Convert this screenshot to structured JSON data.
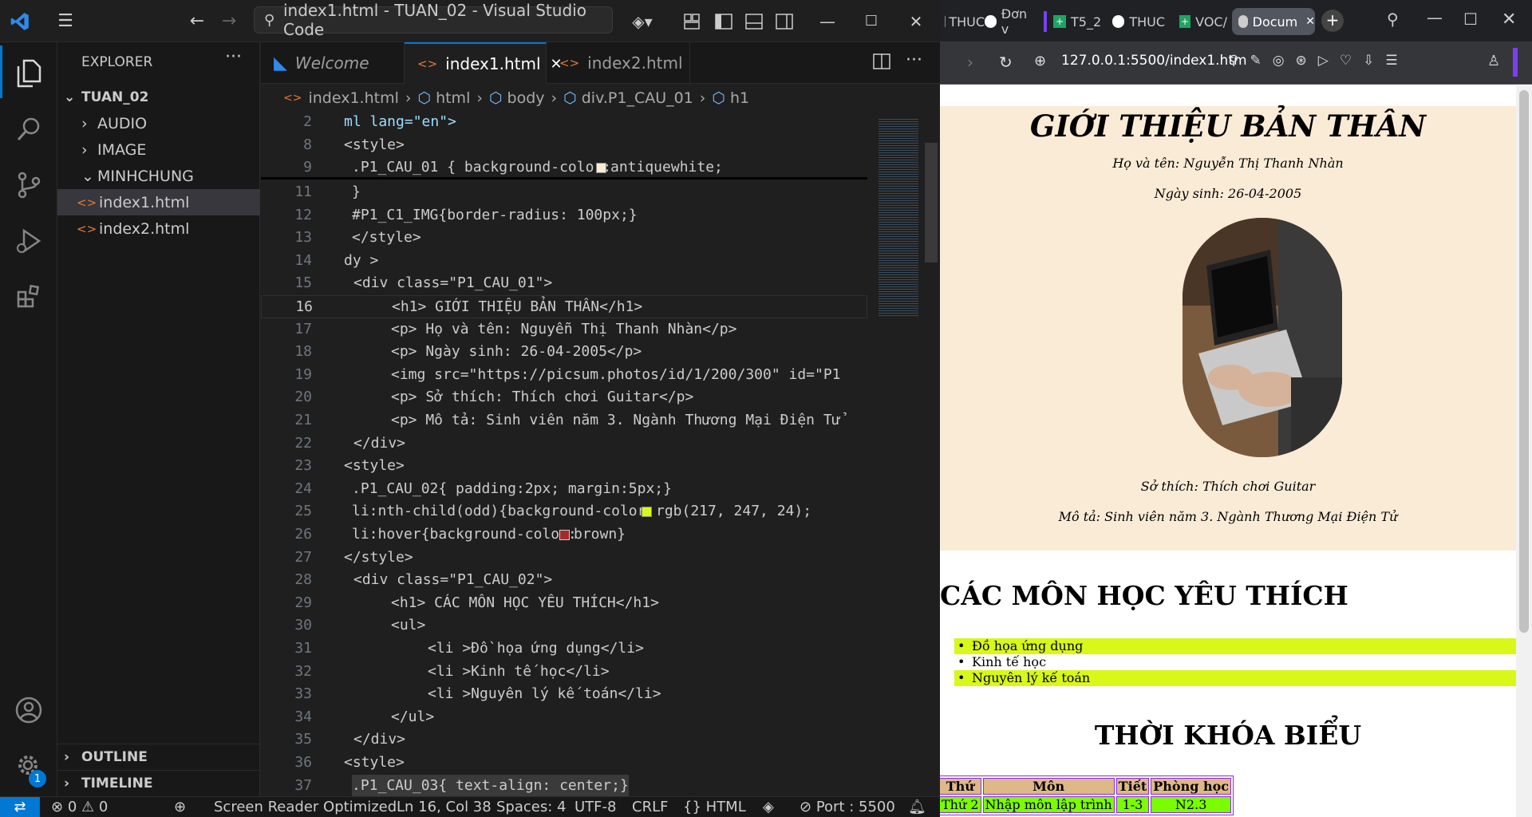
{
  "titlebar": {
    "command_center": "index1.html - TUAN_02 - Visual Studio Code"
  },
  "explorer": {
    "title": "EXPLORER",
    "root": "TUAN_02",
    "folders": [
      "AUDIO",
      "IMAGE",
      "MINHCHUNG"
    ],
    "files": [
      "index1.html",
      "index2.html"
    ],
    "outline": "OUTLINE",
    "timeline": "TIMELINE"
  },
  "tabs": [
    {
      "label": "Welcome"
    },
    {
      "label": "index1.html"
    },
    {
      "label": "index2.html"
    }
  ],
  "breadcrumb": [
    "index1.html",
    "html",
    "body",
    "div.P1_CAU_01",
    "h1"
  ],
  "code_lines": [
    "2",
    "8",
    "9",
    "11",
    "12",
    "13",
    "14",
    "15",
    "16",
    "17",
    "18",
    "19",
    "20",
    "21",
    "22",
    "23",
    "24",
    "25",
    "26",
    "27",
    "28",
    "29",
    "30",
    "31",
    "32",
    "33",
    "34",
    "35",
    "36",
    "37"
  ],
  "code": {
    "l2": "ml lang=\"en\">",
    "l8": "<style>",
    "l9a": ".P1_CAU_01 { background-color:",
    "l9b": "antiquewhite;",
    "l11": "}",
    "l12": "#P1_C1_IMG{border-radius: 100px;}",
    "l13": "</style>",
    "l14": "dy >",
    "l15": "<div class=\"P1_CAU_01\">",
    "l16": "<h1> GIỚI THIỆU BẢN THÂN</h1>",
    "l17": "<p> Họ và tên: Nguyễn Thị Thanh Nhàn</p>",
    "l18": "<p> Ngày sinh: 26-04-2005</p>",
    "l19": "<img src=\"https://picsum.photos/id/1/200/300\" id=\"P1",
    "l20": "<p> Sở thích: Thích chơi Guitar</p>",
    "l21": "<p> Mô tả: Sinh viên năm 3. Ngành Thương Mại Điện Tử",
    "l22": "</div>",
    "l23": "<style>",
    "l24": ".P1_CAU_02{ padding:2px; margin:5px;}",
    "l25a": "li:nth-child(odd){background-color:",
    "l25b": "rgb(217, 247, 24);",
    "l26a": "li:hover{background-color:",
    "l26b": "brown}",
    "l27": "</style>",
    "l28": "<div class=\"P1_CAU_02\">",
    "l29": "<h1> CÁC MÔN HỌC YÊU THÍCH</h1>",
    "l30": "<ul>",
    "l31": "<li >Đồ họa ứng dụng</li>",
    "l32": "<li >Kinh tế học</li>",
    "l33": "<li >Nguyên lý kế toán</li>",
    "l34": "</ul>",
    "l35": "</div>",
    "l36": "<style>",
    "l37": ".P1_CAU_03{ text-align: center;}"
  },
  "colors": {
    "antiquewhite": "#faebd7",
    "lime": "#d9f718",
    "brown": "#a52a2a",
    "accent": "#0078d4"
  },
  "statusbar": {
    "problems": "0",
    "warnings": "0",
    "screen_reader": "Screen Reader Optimized",
    "position": "Ln 16, Col 38",
    "spaces": "Spaces: 4",
    "encoding": "UTF-8",
    "eol": "CRLF",
    "language": "HTML",
    "port": "Port : 5500",
    "badge": "1"
  },
  "browser": {
    "tabs": [
      "THUC",
      "Đơn v",
      "T5_2",
      "THUC",
      "VOC/",
      "Docum"
    ],
    "url": "127.0.0.1:5500/index1.htm"
  },
  "page": {
    "title": "GIỚI THIỆU BẢN THÂN",
    "name": "Họ và tên: Nguyễn Thị Thanh Nhàn",
    "dob": "Ngày sinh: 26-04-2005",
    "hobby": "Sở thích: Thích chơi Guitar",
    "desc": "Mô tả: Sinh viên năm 3. Ngành Thương Mại Điện Tử",
    "subjects_title": "CÁC MÔN HỌC YÊU THÍCH",
    "subjects": [
      "Đồ họa ứng dụng",
      "Kinh tế học",
      "Nguyên lý kế toán"
    ],
    "schedule_title": "THỜI KHÓA BIỂU",
    "table_headers": [
      "Thứ",
      "Môn",
      "Tiết",
      "Phòng học"
    ],
    "table_row1": [
      "Thứ 2",
      "Nhập môn lập trình",
      "1-3",
      "N2.3"
    ]
  }
}
